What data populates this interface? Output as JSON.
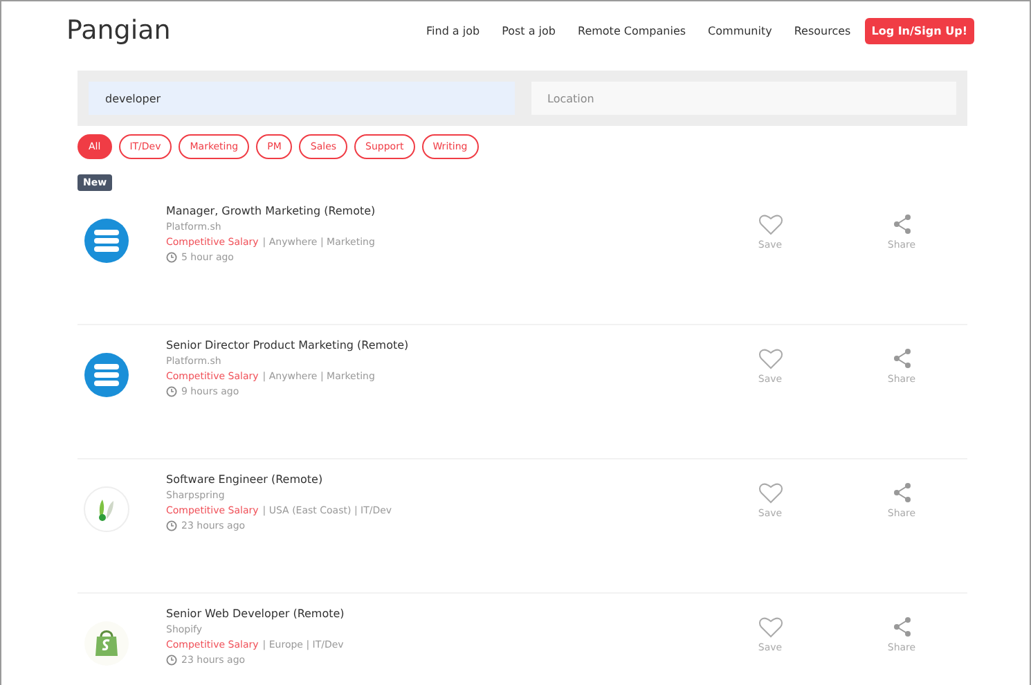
{
  "brand": "Pangian",
  "nav": [
    "Find a job",
    "Post a job",
    "Remote Companies",
    "Community",
    "Resources"
  ],
  "login_button": "Log In/Sign Up!",
  "search": {
    "value": "developer"
  },
  "location": {
    "placeholder": "Location"
  },
  "filters": [
    {
      "label": "All",
      "selected": true
    },
    {
      "label": "IT/Dev",
      "selected": false
    },
    {
      "label": "Marketing",
      "selected": false
    },
    {
      "label": "PM",
      "selected": false
    },
    {
      "label": "Sales",
      "selected": false
    },
    {
      "label": "Support",
      "selected": false
    },
    {
      "label": "Writing",
      "selected": false
    }
  ],
  "badge": "New",
  "jobs": [
    {
      "kind": "stack",
      "title": "Manager, Growth Marketing (Remote)",
      "company": "Platform.sh",
      "salary": "Competitive Salary",
      "details": "| Anywhere | Marketing",
      "time": "5 hour ago",
      "save": "Save",
      "share": "Share"
    },
    {
      "kind": "stack",
      "title": "Senior Director Product Marketing (Remote)",
      "company": "Platform.sh",
      "salary": "Competitive Salary",
      "details": "| Anywhere | Marketing",
      "time": "9 hours ago",
      "save": "Save",
      "share": "Share"
    },
    {
      "kind": "leaf",
      "title": "Software Engineer (Remote)",
      "company": "Sharpspring",
      "salary": "Competitive Salary",
      "details": "| USA (East Coast) | IT/Dev",
      "time": "23 hours ago",
      "save": "Save",
      "share": "Share"
    },
    {
      "kind": "bag",
      "title": "Senior Web Developer (Remote)",
      "company": "Shopify",
      "salary": "Competitive Salary",
      "details": "| Europe | IT/Dev",
      "time": "23 hours ago",
      "save": "Save",
      "share": "Share"
    }
  ]
}
